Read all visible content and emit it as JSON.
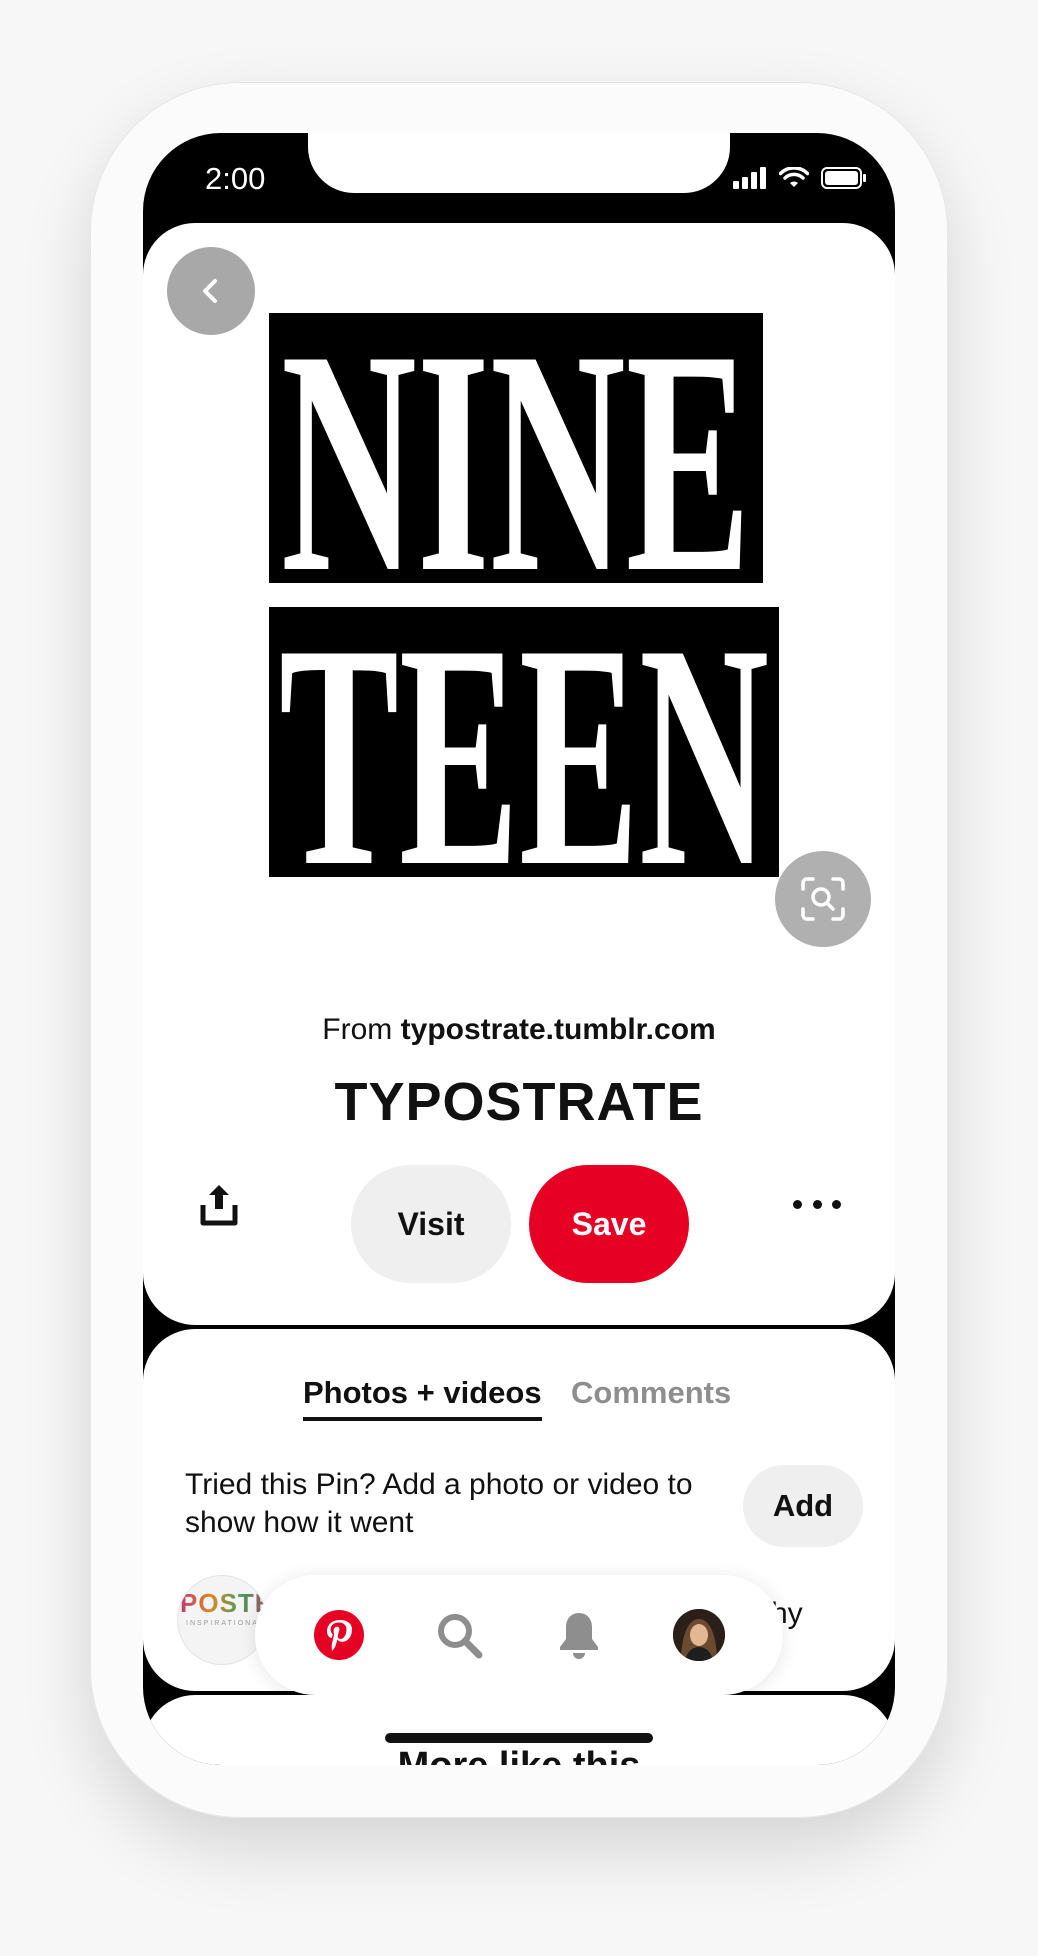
{
  "status_bar": {
    "time": "2:00"
  },
  "pin": {
    "image_words": [
      "NINE",
      "TEEN"
    ],
    "source_prefix": "From",
    "source_domain": "typostrate.tumblr.com",
    "title": "TYPOSTRATE",
    "visit_label": "Visit",
    "save_label": "Save"
  },
  "tried_section": {
    "tabs": [
      {
        "label": "Photos + videos",
        "active": true
      },
      {
        "label": "Comments",
        "active": false
      }
    ],
    "prompt": "Tried this Pin? Add a photo or video to show how it went",
    "add_label": "Add",
    "thumb_text": "POSTE",
    "thumb_sub": "INSPIRATIONAL",
    "partial_label": "hy"
  },
  "more_section": {
    "heading": "More like this"
  },
  "colors": {
    "brand_red": "#e60023",
    "gray_button": "#efefef",
    "inactive_tab": "#8e8e8e"
  },
  "icons": [
    "back-icon",
    "visual-search-icon",
    "share-icon",
    "more-icon",
    "pinterest-logo-icon",
    "search-icon",
    "bell-icon",
    "avatar"
  ]
}
